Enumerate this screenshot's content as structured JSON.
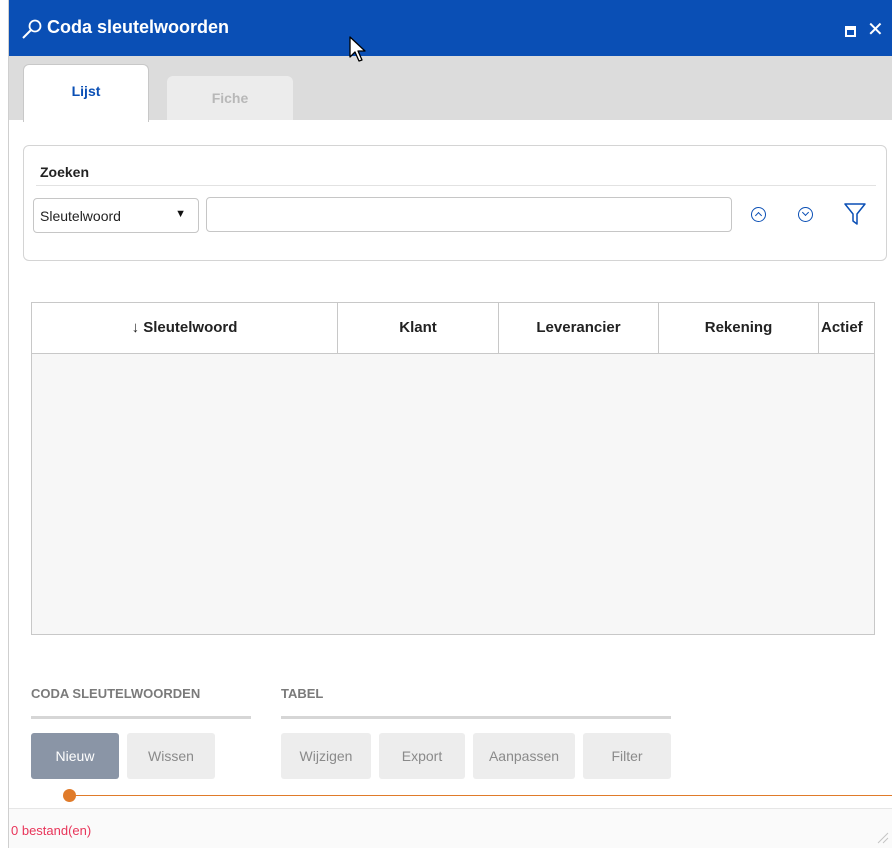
{
  "window": {
    "title": "Coda sleutelwoorden",
    "title_icon": "magnifier-icon",
    "controls": {
      "maximize_icon": "maximize-icon",
      "close_label": "✕"
    }
  },
  "tabs": [
    {
      "label": "Lijst",
      "active": true
    },
    {
      "label": "Fiche",
      "active": false
    }
  ],
  "search": {
    "title": "Zoeken",
    "field_select": {
      "selected": "Sleutelwoord",
      "arrow": "▼"
    },
    "input": {
      "value": "",
      "placeholder": ""
    }
  },
  "grid": {
    "columns": [
      "↓ Sleutelwoord",
      "Klant",
      "Leverancier",
      "Rekening",
      "Actief"
    ],
    "rows": []
  },
  "button_groups": [
    {
      "label": "CODA SLEUTELWOORDEN",
      "buttons": [
        "Nieuw",
        "Wissen"
      ]
    },
    {
      "label": "TABEL",
      "buttons": [
        "Wijzigen",
        "Export",
        "Aanpassen",
        "Filter"
      ]
    }
  ],
  "status": {
    "text": "0 bestand(en)"
  },
  "colors": {
    "titlebar": "#0a4fb5",
    "accent": "#0a4fb5",
    "progress": "#e07b2a",
    "status_text": "#e8355a",
    "primary_button": "#8a95a6"
  }
}
